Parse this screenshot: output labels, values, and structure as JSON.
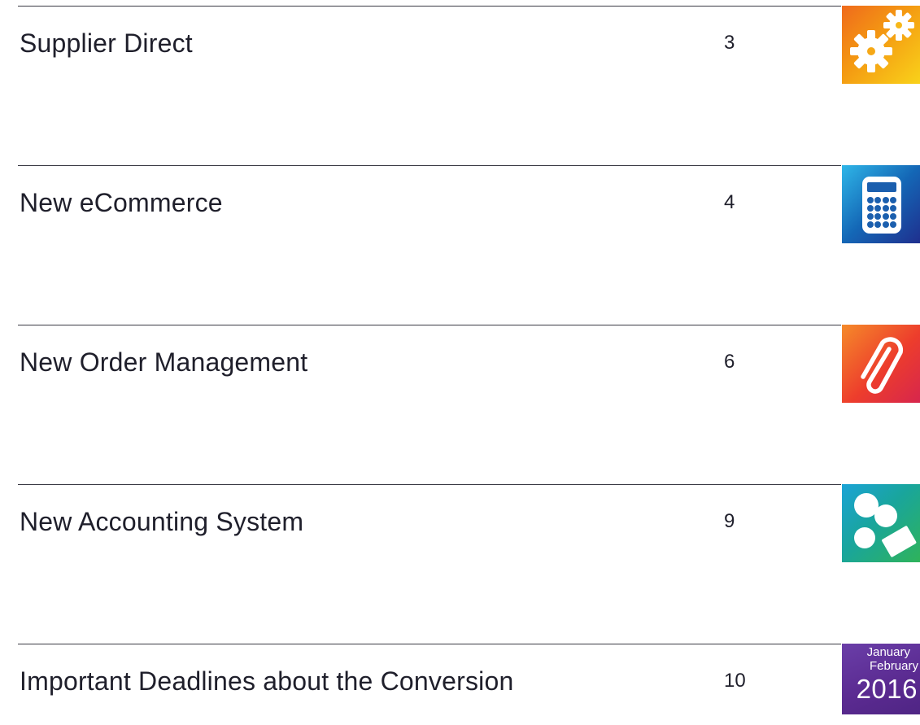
{
  "toc": {
    "entries": [
      {
        "title": "Supplier Direct",
        "page": "3",
        "icon": "gears-icon",
        "color": "#f49a12"
      },
      {
        "title": "New eCommerce",
        "page": "4",
        "icon": "calculator-icon",
        "color": "#1467b6"
      },
      {
        "title": "New Order Management",
        "page": "6",
        "icon": "paperclip-icon",
        "color": "#ed3d2c"
      },
      {
        "title": "New Accounting System",
        "page": "9",
        "icon": "shapes-icon",
        "color": "#19a59c"
      },
      {
        "title": "Important Deadlines about the Conversion",
        "page": "10",
        "icon": "calendar-icon",
        "color": "#5a2a90",
        "calendar": {
          "month1": "January",
          "month2": "February",
          "year": "2016"
        }
      }
    ]
  }
}
